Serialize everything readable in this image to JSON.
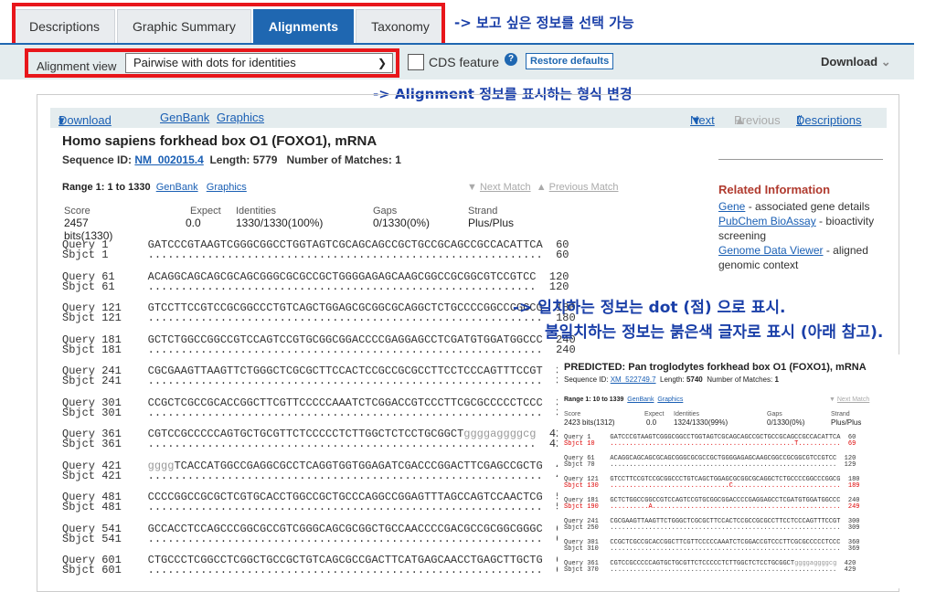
{
  "tabs": [
    "Descriptions",
    "Graphic Summary",
    "Alignments",
    "Taxonomy"
  ],
  "annotations": {
    "a1": "-> 보고 싶은 정보를 선택 가능",
    "a2": "-> Alignment 정보를 표시하는 형식 변경",
    "a3": "-> 일치하는 정보는 dot (점) 으로 표시.",
    "a4": "불일치하는 정보는 붉은색 글자로 표시 (아래 참고)."
  },
  "toolbar": {
    "view_label": "Alignment view",
    "view_value": "Pairwise with dots for identities",
    "cds": "CDS feature",
    "help": "?",
    "restore": "Restore defaults",
    "download": "Download"
  },
  "bar": {
    "download": "Download",
    "genbank": "GenBank",
    "graphics": "Graphics",
    "next": "Next",
    "previous": "Previous",
    "descriptions": "Descriptions"
  },
  "hit": {
    "title": "Homo sapiens forkhead box O1 (FOXO1), mRNA",
    "seq_label": "Sequence ID:",
    "seq_id": "NM_002015.4",
    "length_label": "Length:",
    "length": "5779",
    "matches_label": "Number of Matches:",
    "matches": "1",
    "range": "Range 1: 1 to 1330",
    "genbank": "GenBank",
    "graphics": "Graphics",
    "next_match": "Next Match",
    "previous_match": "Previous Match"
  },
  "stats": {
    "headers": [
      "Score",
      "Expect",
      "Identities",
      "Gaps",
      "Strand"
    ],
    "values": [
      "2457 bits(1330)",
      "0.0",
      "1330/1330(100%)",
      "0/1330(0%)",
      "Plus/Plus"
    ]
  },
  "alignment": [
    {
      "qs": "1",
      "ss": "1",
      "seq": "GATCCCGTAAGTCGGGCGGCCTGGTAGTCGCAGCAGCCGCTGCCGCAGCCGCCACATTCA",
      "qe": "60",
      "se": "60"
    },
    {
      "qs": "61",
      "ss": "61",
      "seq": "ACAGGCAGCAGCGCAGCGGGCGCGCCGCTGGGGAGAGCAAGCGGCCGCGGCGTCCGTCC",
      "qe": "120",
      "se": "120"
    },
    {
      "qs": "121",
      "ss": "121",
      "seq": "GTCCTTCCGTCCGCGGCCCTGTCAGCTGGAGCGCGGCGCAGGCTCTGCCCCGGCCCGGCG",
      "qe": "180",
      "se": "180"
    },
    {
      "qs": "181",
      "ss": "181",
      "seq": "GCTCTGGCCGGCCGTCCAGTCCGTGCGGCGGACCCCGAGGAGCCTCGATGTGGATGGCCC",
      "qe": "240",
      "se": "240"
    },
    {
      "qs": "241",
      "ss": "241",
      "seq": "CGCGAAGTTAAGTTCTGGGCTCGCGCTTCCACTCCGCCGCGCCTTCCTCCCAGTTTCCGT",
      "qe": "300",
      "se": "300"
    },
    {
      "qs": "301",
      "ss": "301",
      "seq": "CCGCTCGCCGCACCGGCTTCGTTCCCCCAAATCTCGGACCGTCCCTTCGCGCCCCCTCCC",
      "qe": "360",
      "se": "360"
    },
    {
      "qs": "361",
      "ss": "361",
      "seq": "CGTCCGCCCCCAGTGCTGCGTTCTCCCCCTCTTGGCTCTCCTGCGGCT",
      "gray": "ggggaggggcg",
      "qe": "420",
      "se": "420"
    },
    {
      "qs": "421",
      "ss": "421",
      "graypre": "gggg",
      "seq": "TCACCATGGCCGAGGCGCCTCAGGTGGTGGAGATCGACCCGGACTTCGAGCCGCTG",
      "qe": "480",
      "se": "480"
    },
    {
      "qs": "481",
      "ss": "481",
      "seq": "CCCCGGCCGCGCTCGTGCACCTGGCCGCTGCCCAGGCCGGAGTTTAGCCAGTCCAACTCG",
      "qe": "540",
      "se": "540"
    },
    {
      "qs": "541",
      "ss": "541",
      "seq": "GCCACCTCCAGCCCGGCGCCGTCGGGCAGCGCGGCTGCCAACCCCGACGCCGCGGCGGGC",
      "qe": "600",
      "se": "600"
    },
    {
      "qs": "601",
      "ss": "601",
      "seq": "CTGCCCTCGGCCTCGGCTGCCGCTGTCAGCGCCGACTTCATGAGCAACCTGAGCTTGCTG",
      "qe": "660",
      "se": "660"
    }
  ],
  "related": {
    "heading": "Related Information",
    "gene": "Gene",
    "gene_desc": " - associated gene details",
    "pubchem": "PubChem BioAssay",
    "pubchem_desc": " - bioactivity screening",
    "gdv": "Genome Data Viewer",
    "gdv_desc": " - aligned genomic context"
  },
  "inset": {
    "title": "PREDICTED: Pan troglodytes forkhead box O1 (FOXO1), mRNA",
    "seq_label": "Sequence ID:",
    "seq_id": "XM_522749.7",
    "length_label": "Length:",
    "length": "5740",
    "matches_label": "Number of Matches:",
    "matches": "1",
    "range": "Range 1: 10 to 1339",
    "genbank": "GenBank",
    "graphics": "Graphics",
    "next_match": "Next Match",
    "stats": [
      "2423 bits(1312)",
      "0.0",
      "1324/1330(99%)",
      "0/1330(0%)",
      "Plus/Plus"
    ],
    "rows": [
      {
        "qs": "1",
        "ss": "10",
        "seq": "GATCCCGTAAGTCGGGCGGCCTGGTAGTCGCAGCAGCCGCTGCCGCAGCCGCCACATTCA",
        "qe": "60",
        "se": "69",
        "mm": "T",
        "mmpos": 48
      },
      {
        "qs": "61",
        "ss": "70",
        "seq": "ACAGGCAGCAGCGCAGCGGGCGCGCCGCTGGGGAGAGCAAGCGGCCGCGGCGTCCGTCC",
        "qe": "120",
        "se": "129"
      },
      {
        "qs": "121",
        "ss": "130",
        "seq": "GTCCTTCCGTCCGCGGCCCTGTCAGCTGGAGCGCGGCGCAGGCTCTGCCCCGGCCCGGCG",
        "qe": "180",
        "se": "189",
        "mm": "C",
        "mmpos": 31
      },
      {
        "qs": "181",
        "ss": "190",
        "seq": "GCTCTGGCCGGCCGTCCAGTCCGTGCGGCGGACCCCGAGGAGCCTCGATGTGGATGGCCC",
        "qe": "240",
        "se": "249",
        "mm": "A",
        "mmpos": 10
      },
      {
        "qs": "241",
        "ss": "250",
        "seq": "CGCGAAGTTAAGTTCTGGGCTCGCGCTTCCACTCCGCCGCGCCTTCCTCCCAGTTTCCGT",
        "qe": "300",
        "se": "309"
      },
      {
        "qs": "301",
        "ss": "310",
        "seq": "CCGCTCGCCGCACCGGCTTCGTTCCCCCAAATCTCGGACCGTCCCTTCGCGCCCCCTCCC",
        "qe": "360",
        "se": "369"
      },
      {
        "qs": "361",
        "ss": "370",
        "seq": "CGTCCGCCCCCAGTGCTGCGTTCTCCCCCTCTTGGCTCTCCTGCGGCT",
        "gray": "ggggaggggcg",
        "qe": "420",
        "se": "429"
      }
    ]
  }
}
